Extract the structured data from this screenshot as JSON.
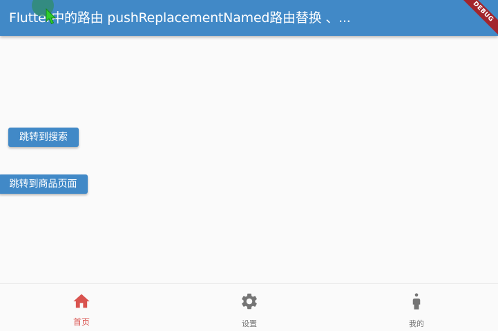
{
  "app_bar": {
    "title": "Flutter中的路由 pushReplacementNamed路由替换 、..."
  },
  "debug_banner": {
    "label": "DEBUG"
  },
  "main": {
    "buttons": [
      {
        "label": "跳转到搜索"
      },
      {
        "label": "跳转到商品页面"
      }
    ]
  },
  "bottom_nav": {
    "items": [
      {
        "label": "首页",
        "icon": "home-icon",
        "active": true
      },
      {
        "label": "设置",
        "icon": "settings-icon",
        "active": false
      },
      {
        "label": "我的",
        "icon": "person-icon",
        "active": false
      }
    ]
  },
  "colors": {
    "primary": "#4189c7",
    "active_tab": "#d9534f",
    "inactive_tab": "#757575",
    "debug_banner": "#a2252d",
    "background": "#fafafa"
  }
}
